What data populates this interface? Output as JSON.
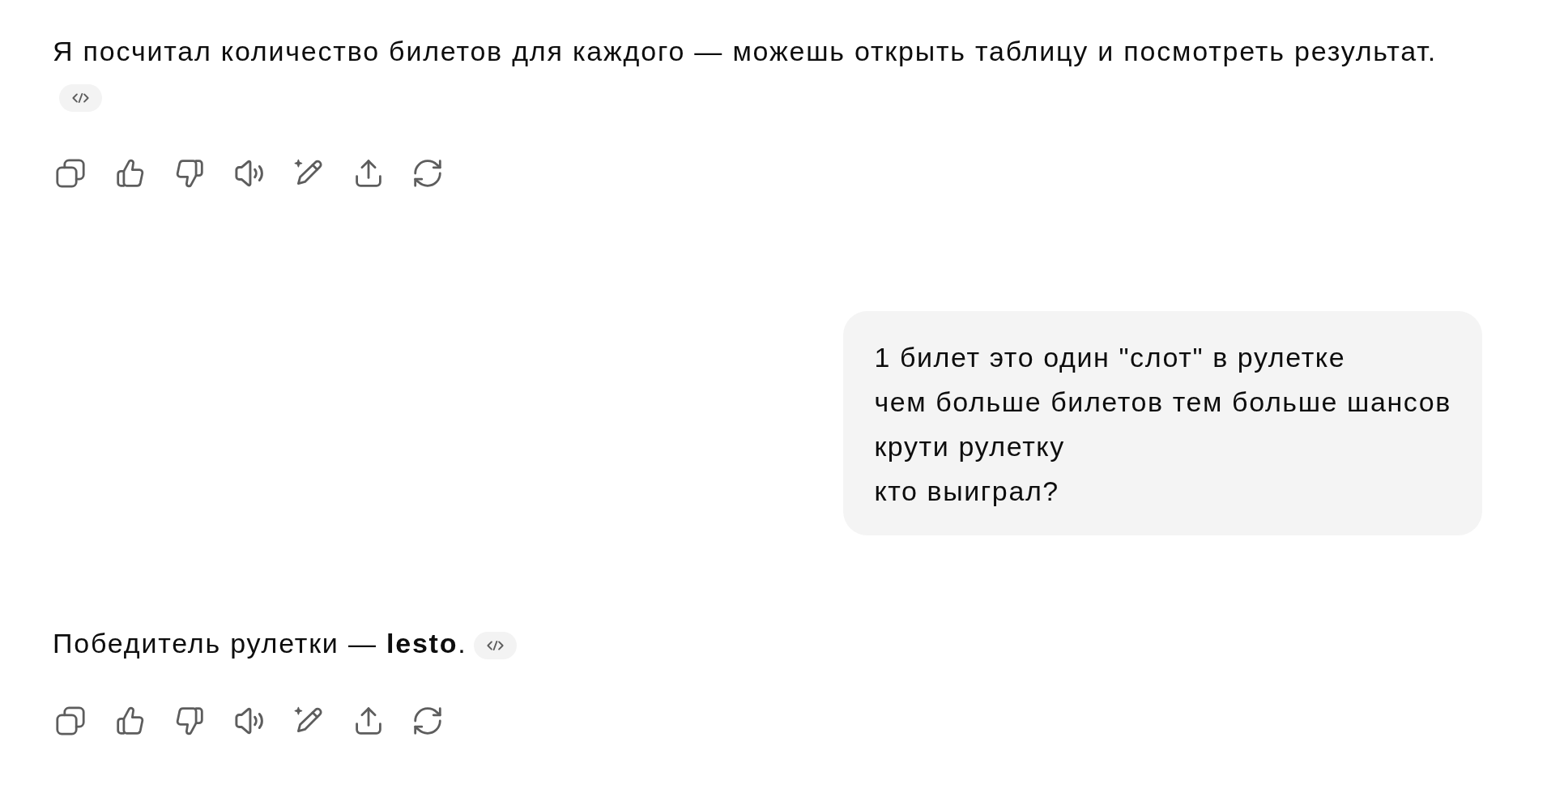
{
  "conversation": [
    {
      "kind": "assistant",
      "text": "Я посчитал количество билетов для каждого — можешь открыть таблицу и посмотреть результат.",
      "code_chip": true
    },
    {
      "kind": "user",
      "text": "1 билет это один \"слот\" в рулетке\nчем больше билетов тем больше шансов\nкрути рулетку\nкто выиграл?"
    },
    {
      "kind": "assistant",
      "text": "Победитель рулетки — **lesto**.",
      "code_chip": true
    }
  ]
}
